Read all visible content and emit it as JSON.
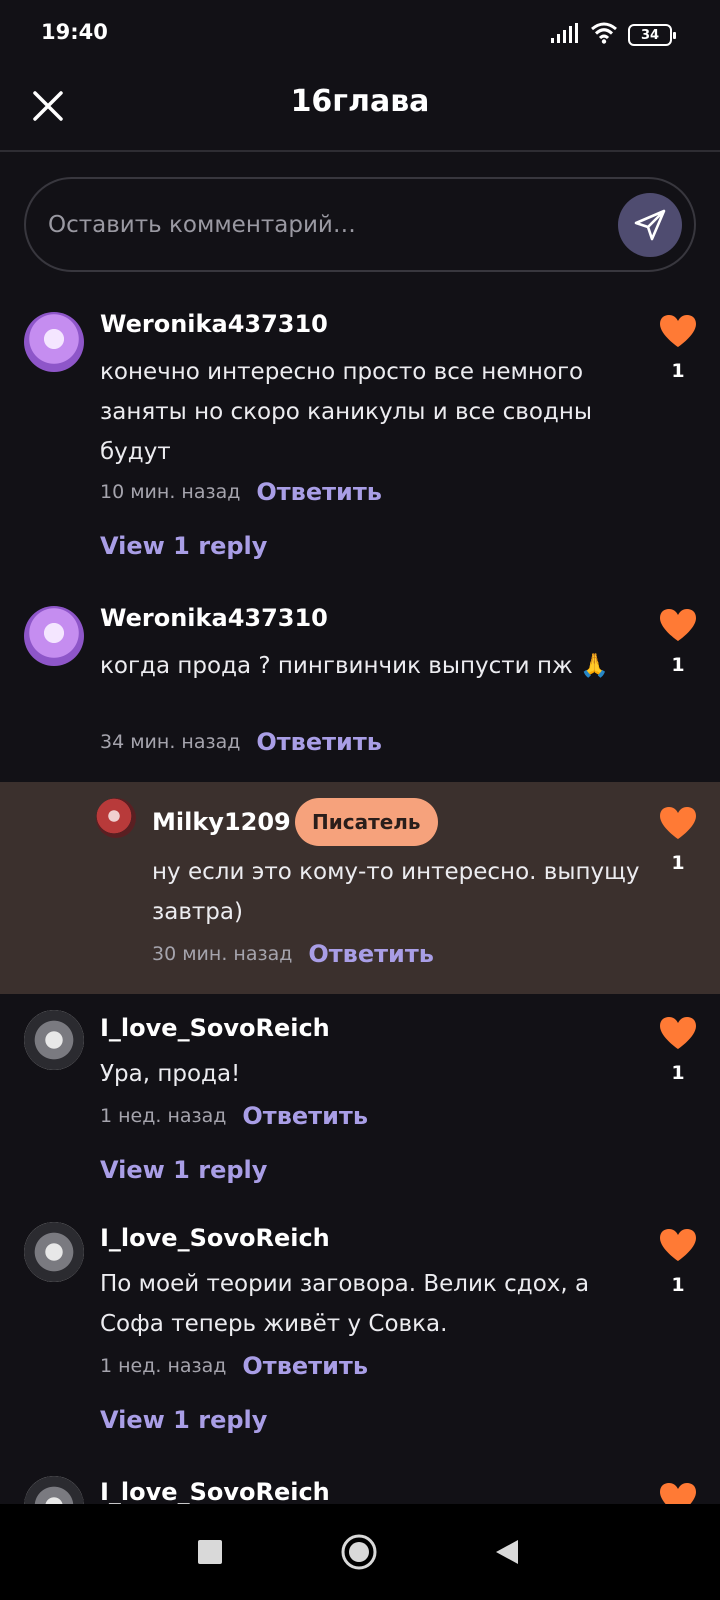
{
  "status_bar": {
    "time": "19:40",
    "battery": "34"
  },
  "header": {
    "title": "16глава"
  },
  "comment_box": {
    "placeholder": "Оставить комментарий…"
  },
  "comments": [
    {
      "username": "Weronika437310",
      "text": "конечно интересно просто все немного заняты но скоро каникулы и все сводны будут",
      "time": "10 мин. назад",
      "reply_label": "Ответить",
      "likes": "1",
      "view_replies": "View 1 reply",
      "avatar_icon": "avatar-purple-hair"
    },
    {
      "username": "Weronika437310",
      "text": "когда прода ? пингвинчик выпусти пж 🙏",
      "time": "34 мин. назад",
      "reply_label": "Ответить",
      "likes": "1",
      "avatar_icon": "avatar-purple-hair"
    },
    {
      "username": "Milky1209",
      "badge": "Писатель",
      "text": "ну если это кому-то интересно. выпущу завтра)",
      "time": "30 мин. назад",
      "reply_label": "Ответить",
      "likes": "1",
      "avatar_icon": "avatar-red"
    },
    {
      "username": "I_love_SovoReich",
      "text": "Ура, прода!",
      "time": "1 нед. назад",
      "reply_label": "Ответить",
      "likes": "1",
      "view_replies": "View 1 reply",
      "avatar_icon": "avatar-gray"
    },
    {
      "username": "I_love_SovoReich",
      "text": "По моей теории заговора. Велик сдох, а Софа теперь живёт у Совка.",
      "time": "1 нед. назад",
      "reply_label": "Ответить",
      "likes": "1",
      "view_replies": "View 1 reply",
      "avatar_icon": "avatar-gray"
    },
    {
      "username": "I_love_SovoReich",
      "avatar_icon": "avatar-gray"
    }
  ],
  "colors": {
    "background": "#121116",
    "accent": "#a99ee6",
    "heart": "#ff7a35",
    "badge": "#f6a27c",
    "highlight": "#3b302d"
  }
}
